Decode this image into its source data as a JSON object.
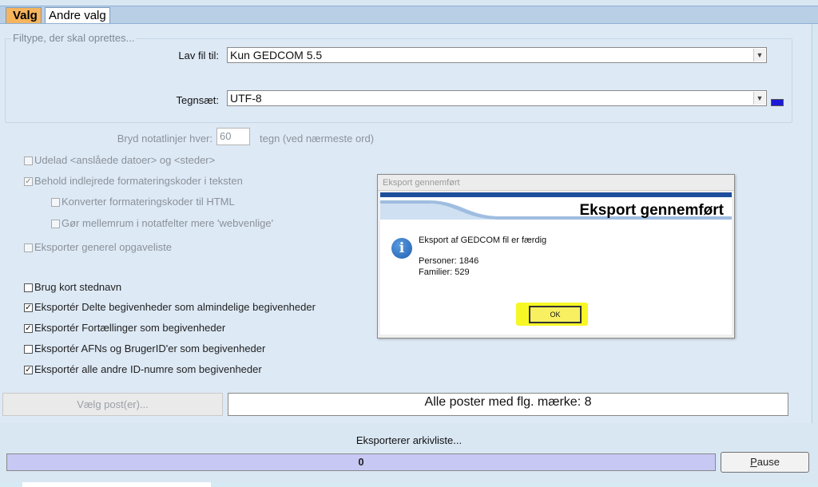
{
  "tabs": [
    {
      "label": "Valg",
      "active": true
    },
    {
      "label": "Andre valg",
      "active": false
    }
  ],
  "filetype_group": {
    "title": "Filtype, der skal oprettes...",
    "make_file_label": "Lav fil til:",
    "make_file_value": "Kun GEDCOM 5.5",
    "charset_label": "Tegnsæt:",
    "charset_value": "UTF-8",
    "charset_color": "#1a1ad8"
  },
  "wrap": {
    "label": "Bryd notatlinjer hver:",
    "value": "60",
    "suffix": "tegn (ved nærmeste ord)"
  },
  "options_disabled": [
    {
      "label": "Udelad <anslåede datoer> og <steder>",
      "checked": false
    },
    {
      "label": "Behold indlejrede formateringskoder i teksten",
      "checked": true
    },
    {
      "label": "Konverter formateringskoder til HTML",
      "checked": false
    },
    {
      "label": "Gør mellemrum i notatfelter mere 'webvenlige'",
      "checked": false
    },
    {
      "label": "Eksporter generel opgaveliste",
      "checked": false
    }
  ],
  "options": [
    {
      "label": "Brug kort stednavn",
      "checked": false
    },
    {
      "label": "Eksportér Delte begivenheder som almindelige begivenheder",
      "checked": true
    },
    {
      "label": "Eksportér Fortællinger som begivenheder",
      "checked": true
    },
    {
      "label": "Eksportér AFNs og BrugerID'er som begivenheder",
      "checked": false
    },
    {
      "label": "Eksportér alle andre ID-numre som begivenheder",
      "checked": true
    }
  ],
  "select_records_label": "Vælg post(er)...",
  "records_mark": "Alle poster med flg. mærke: 8",
  "status_text": "Eksporterer arkivliste...",
  "progress_value": "0",
  "pause_label_first": "P",
  "pause_label_rest": "ause",
  "dialog": {
    "title": "Eksport gennemført",
    "heading": "Eksport gennemført",
    "message": "Eksport af GEDCOM fil er færdig",
    "persons": "Personer: 1846",
    "families": "Familier: 529",
    "ok_label": "OK",
    "icon": "info-icon"
  }
}
